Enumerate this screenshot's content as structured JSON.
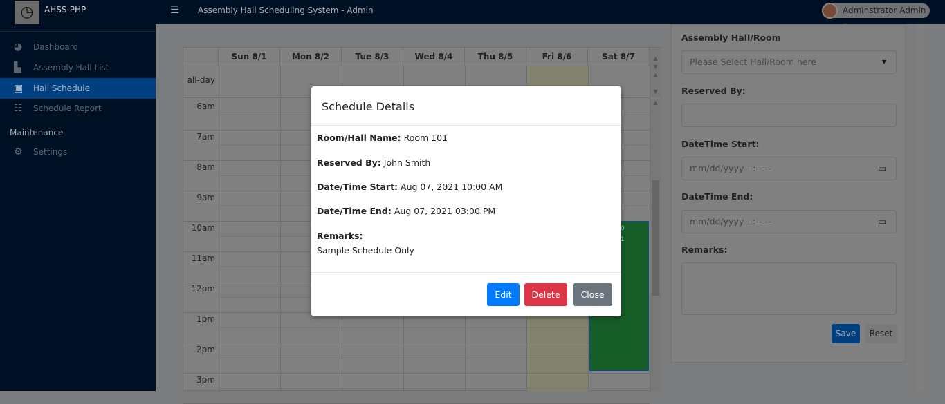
{
  "app": {
    "brand": "AHSS-PHP",
    "title": "Assembly Hall Scheduling System - Admin",
    "user": "Adminstrator Admin"
  },
  "sidebar": {
    "items": [
      {
        "label": "Dashboard",
        "icon": "tachometer-icon"
      },
      {
        "label": "Assembly Hall List",
        "icon": "building-icon"
      },
      {
        "label": "Hall Schedule",
        "icon": "calendar-icon",
        "active": true
      },
      {
        "label": "Schedule Report",
        "icon": "list-icon"
      }
    ],
    "section": "Maintenance",
    "settings": "Settings"
  },
  "calendar": {
    "days": [
      "Sun 8/1",
      "Mon 8/2",
      "Tue 8/3",
      "Wed 8/4",
      "Thu 8/5",
      "Fri 8/6",
      "Sat 8/7"
    ],
    "allday": "all-day",
    "times": [
      "6am",
      "7am",
      "8am",
      "9am",
      "10am",
      "11am",
      "12pm",
      "1pm",
      "2pm",
      "3pm"
    ],
    "event": {
      "line1": "0",
      "line2": "1",
      "color": "#28a745"
    }
  },
  "form": {
    "hall_label": "Assembly Hall/Room",
    "hall_placeholder": "Please Select Hall/Room here",
    "reserved_label": "Reserved By:",
    "start_label": "DateTime Start:",
    "start_placeholder": "mm/dd/yyyy --:-- --",
    "end_label": "DateTime End:",
    "end_placeholder": "mm/dd/yyyy --:-- --",
    "remarks_label": "Remarks:",
    "save": "Save",
    "reset": "Reset"
  },
  "modal": {
    "title": "Schedule Details",
    "room_label": "Room/Hall Name:",
    "room": "Room 101",
    "reserved_label": "Reserved By:",
    "reserved": "John Smith",
    "start_label": "Date/Time Start:",
    "start": "Aug 07, 2021 10:00 AM",
    "end_label": "Date/Time End:",
    "end": "Aug 07, 2021 03:00 PM",
    "remarks_label": "Remarks:",
    "remarks": "Sample Schedule Only",
    "edit": "Edit",
    "delete": "Delete",
    "close": "Close"
  },
  "colors": {
    "primary": "#007bff",
    "danger": "#dc3545",
    "secondary": "#6c757d"
  }
}
